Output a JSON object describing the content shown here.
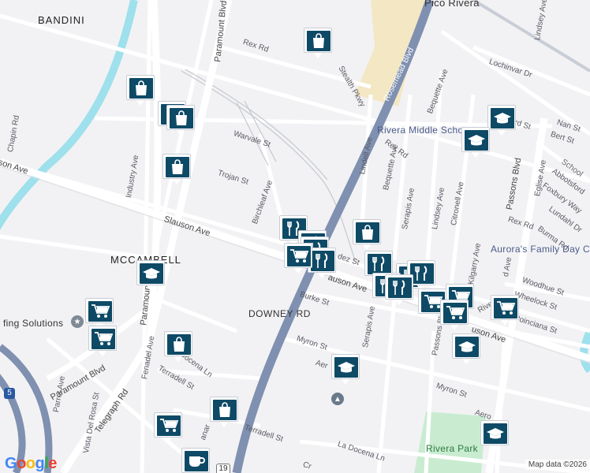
{
  "map": {
    "areas": {
      "bandini": "BANDINI",
      "mccambell": "MCCAMBELL",
      "pico_rivera": "Pico Rivera"
    },
    "major_roads": {
      "downey_rd": "DOWNEY RD",
      "slauson_ave": "Slauson Ave",
      "slauson_ave_east": "auson Ave",
      "slauson_ave_far": "uson Ave",
      "rosemead_blvd": "Rosemead Blvd",
      "paramount_blvd_north": "Paramount Blvd",
      "paramount_blvd_mid": "Paramount",
      "paramount_blvd_south": "Paramount Blvd",
      "passons_blvd": "Passons Blvd",
      "passons_blvd_south": "Passons Blvd",
      "telegraph_rd": "Telegraph Rd",
      "route_19": "19",
      "route_5": "5"
    },
    "streets": {
      "rex_rd_west": "Rex Rd",
      "rex_rd_mid": "Rex Rd",
      "rex_rd_east": "Rex Rd",
      "stealth_pkwy": "Stealth Pkwy",
      "warvale_st": "Warvale St",
      "trojan_st": "Trojan St",
      "birchleaf_ave": "Birchleaf Ave",
      "industry_ave": "Industry Ave",
      "chapin_rd": "Chapin Rd",
      "son_ave": "son Ave",
      "lindell_ave": "Lindell Ave",
      "bequette_ave_n": "Bequette Ave",
      "bequette_ave_s": "Bequette Ave",
      "lochinvar_dr": "Lochinvar Dr",
      "lindsey_ave_n": "Lindsey Ave",
      "lindsey_ave_s": "Lindsey Ave",
      "serapis_ave_n": "Serapis Ave",
      "serapis_ave_s": "Serapis Ave",
      "citronell_ave": "Citronell Ave",
      "kilgarry_ave": "Kilgarry Ave",
      "nan_st": "Nan St",
      "bert_st": "Bert St",
      "schoolhouse": "School",
      "abbotsford": "Abbotsford",
      "eglise_ave": "Eglise Ave",
      "foxbury_way": "Foxbury Way",
      "lundahl_dr": "Lundahl Dr",
      "burma_rd": "Burma Rd",
      "rd_st": "rd St",
      "rex_rd_se": "Rex Rd",
      "woodhue_st": "Woodhue St",
      "wheelock_st": "Wheelock St",
      "poinciana_st": "Poinciana St",
      "rivera_fragment": "Rive",
      "d_ave": "d Ave",
      "dez_st": "dez St",
      "burke_st": "Burke St",
      "myron_st_w": "Myron St",
      "myron_st_e": "Myron St",
      "aer_1": "Aer",
      "aer_2": "Aero",
      "fenadel_ave": "Fenadel Ave",
      "terradell_st_w": "Terradell St",
      "terradell_st_s": "Terradell St",
      "docena_ln": "Docena Ln",
      "la_docena_ln": "La Docena Ln",
      "parrot_ave": "Parrot Ave",
      "vista_del_rosa": "Vista Del Rosa St",
      "manar": "anar",
      "cr": "Cr"
    },
    "places": {
      "rivera_middle_school": "Rivera Middle Scho",
      "aurora_day_care": "Aurora's Family Day Care",
      "rivera_park": "Rivera Park",
      "roofing_solutions": "fing Solutions"
    },
    "attribution": "Map data ©2026",
    "logo": "Google"
  },
  "icons": {
    "shopping_bag": "shopping-bag-icon",
    "shopping_cart": "shopping-cart-icon",
    "restaurant": "restaurant-icon",
    "school": "school-icon",
    "cafe": "cafe-icon"
  },
  "colors": {
    "pin_fill": "#0e4a66",
    "water": "#9ee0ec",
    "highway": "#7f90b0",
    "commercial": "#f3e7c4",
    "park": "#c9ecd1"
  }
}
